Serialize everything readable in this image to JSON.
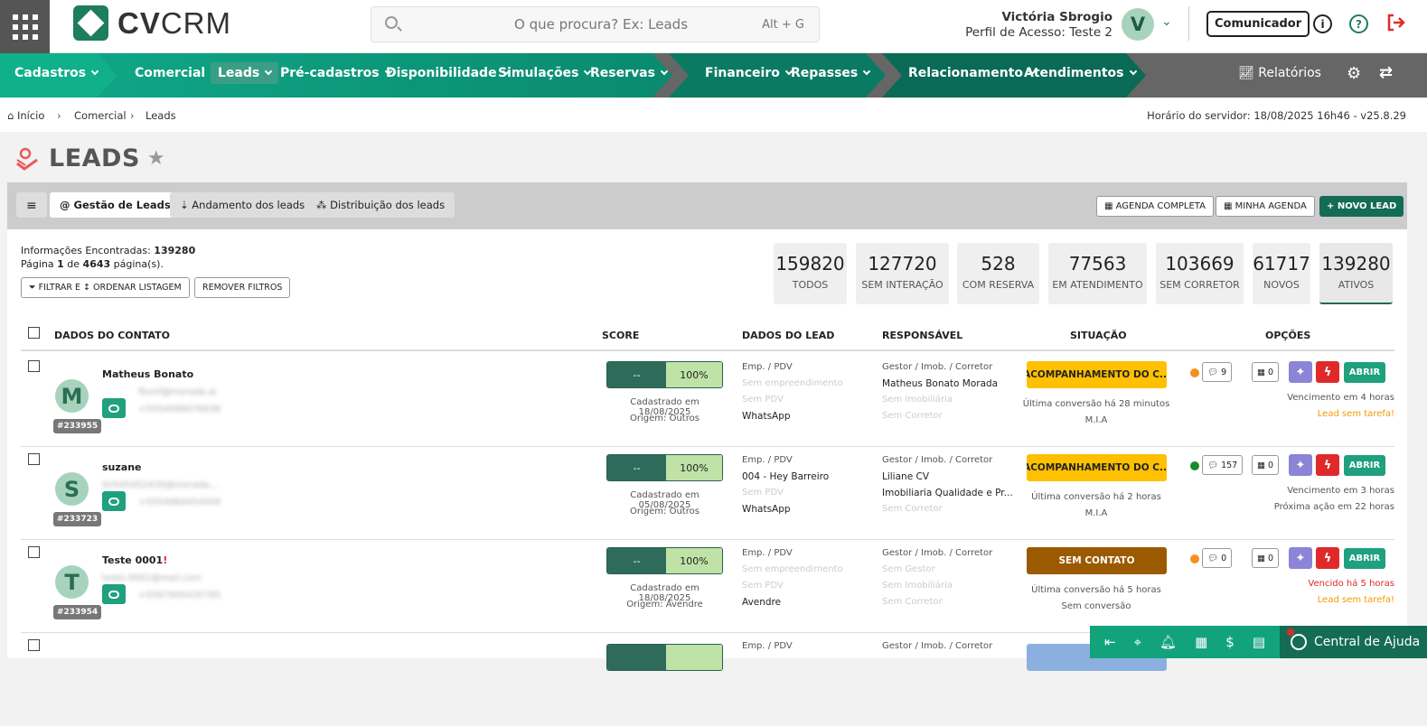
{
  "app": {
    "brand_left": "CV",
    "brand_right": "CRM"
  },
  "search": {
    "placeholder": "O que procura? Ex: Leads",
    "shortcut": "Alt + G"
  },
  "user": {
    "name": "Victória Sbrogio",
    "profile": "Perfil de Acesso: Teste 2",
    "initial": "V"
  },
  "header": {
    "comunicador": "Comunicador"
  },
  "nav": [
    {
      "label": "Cadastros"
    },
    {
      "label": "Comercial"
    },
    {
      "label": "Leads"
    },
    {
      "label": "Pré-cadastros"
    },
    {
      "label": "Disponibilidade"
    },
    {
      "label": "Simulações"
    },
    {
      "label": "Reservas"
    },
    {
      "label": "Financeiro"
    },
    {
      "label": "Repasses"
    },
    {
      "label": "Relacionamento"
    },
    {
      "label": "Atendimentos"
    }
  ],
  "nav_right": {
    "reports": "Relatórios"
  },
  "breadcrumb": [
    "Início",
    "Comercial",
    "Leads"
  ],
  "server_time": "Horário do servidor: 18/08/2025 16h46 - v25.8.29",
  "page": {
    "title": "LEADS"
  },
  "tabs": [
    "@ Gestão de Leads",
    "Andamento dos leads",
    "Distribuição dos leads"
  ],
  "actions": {
    "agenda_completa": "AGENDA COMPLETA",
    "minha_agenda": "MINHA AGENDA",
    "novo_lead": "+ NOVO LEAD"
  },
  "info": {
    "found_label": "Informações Encontradas:",
    "found": "139280",
    "page_label": "Página",
    "page": "1",
    "of": "de",
    "pages": "4643",
    "pages_suffix": "página(s)."
  },
  "filters": {
    "filter": "FILTRAR E ↕ ORDENAR LISTAGEM",
    "remove": "REMOVER FILTROS"
  },
  "stats": [
    {
      "num": "159820",
      "label": "TODOS"
    },
    {
      "num": "127720",
      "label": "SEM INTERAÇÃO"
    },
    {
      "num": "528",
      "label": "COM RESERVA"
    },
    {
      "num": "77563",
      "label": "EM ATENDIMENTO"
    },
    {
      "num": "103669",
      "label": "SEM CORRETOR"
    },
    {
      "num": "61717",
      "label": "NOVOS"
    },
    {
      "num": "139280",
      "label": "ATIVOS"
    }
  ],
  "columns": {
    "contact": "DADOS DO CONTATO",
    "score": "SCORE",
    "lead": "DADOS DO LEAD",
    "resp": "RESPONSÁVEL",
    "situation": "SITUAÇÃO",
    "options": "OPÇÕES"
  },
  "rows": [
    {
      "initial": "M",
      "id": "#233955",
      "name": "Matheus Bonato",
      "email": "fbonf@morada.ai",
      "phone": "+5554999976638",
      "score_l": "--",
      "score_r": "100%",
      "cad": "Cadastrado em 18/08/2025",
      "origem": "Origem: Outros",
      "emp_label": "Emp. / PDV",
      "emp": "Sem empreendimento",
      "pdv": "Sem PDV",
      "channel": "WhatsApp",
      "resp_label": "Gestor / Imob. / Corretor",
      "gestor": "Matheus Bonato Morada",
      "imob": "Sem Imobiliária",
      "corretor": "Sem Corretor",
      "situation": "ACOMPANHAMENTO DO C...",
      "conv": "Última conversão há 28 minutos",
      "conv2": "M.I.A",
      "msgs": "9",
      "cal": "0",
      "venc": "Vencimento em 4 horas",
      "task": "Lead sem tarefa!"
    },
    {
      "initial": "S",
      "id": "#233723",
      "name": "suzane",
      "email": "92545452435@morada...",
      "phone": "+5554984454509",
      "score_l": "--",
      "score_r": "100%",
      "cad": "Cadastrado em 05/08/2025",
      "origem": "Origem: Outros",
      "emp_label": "Emp. / PDV",
      "emp": "004 - Hey Barreiro",
      "pdv": "Sem PDV",
      "channel": "WhatsApp",
      "resp_label": "Gestor / Imob. / Corretor",
      "gestor": "Liliane CV",
      "imob": "Imobiliaria Qualidade e Pr...",
      "corretor": "Sem Corretor",
      "situation": "ACOMPANHAMENTO DO C...",
      "conv": "Última conversão há 2 horas",
      "conv2": "M.I.A",
      "msgs": "157",
      "cal": "0",
      "venc": "Vencimento em 3 horas",
      "task": "Próxima ação em 22 horas"
    },
    {
      "initial": "T",
      "id": "#233954",
      "name": "Teste 0001",
      "email": "teste.0001@mail.com",
      "phone": "+5567945435795",
      "score_l": "--",
      "score_r": "100%",
      "cad": "Cadastrado em 18/08/2025",
      "origem": "Origem: Avendre",
      "emp_label": "Emp. / PDV",
      "emp": "Sem empreendimento",
      "pdv": "Sem PDV",
      "channel": "Avendre",
      "resp_label": "Gestor / Imob. / Corretor",
      "gestor": "Sem Gestor",
      "imob": "Sem Imobiliária",
      "corretor": "Sem Corretor",
      "situation": "SEM CONTATO",
      "conv": "Última conversão há 5 horas",
      "conv2": "Sem conversão",
      "msgs": "0",
      "cal": "0",
      "venc": "Vencido há 5 horas",
      "task": "Lead sem tarefa!"
    },
    {
      "emp_label": "Emp. / PDV",
      "resp_label": "Gestor / Imob. / Corretor"
    }
  ],
  "abrir": "ABRIR",
  "help": "Central de Ajuda",
  "colors": {
    "green": "#1fa07e",
    "dark_green": "#146c55",
    "yellow": "#ffc000",
    "brown": "#9b5a00",
    "orange": "#f5901e",
    "red": "#e02a2a"
  }
}
